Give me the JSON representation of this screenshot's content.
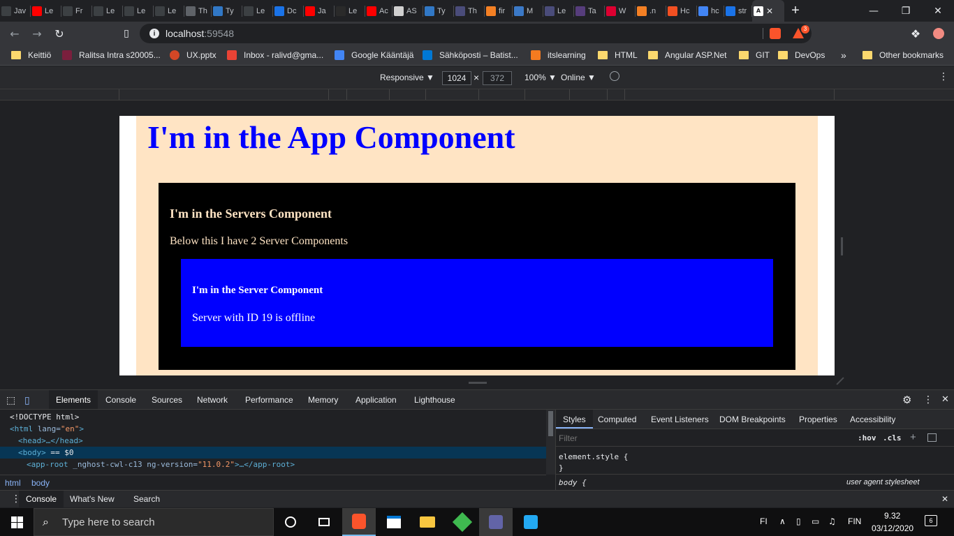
{
  "browser": {
    "tabs": [
      {
        "title": "Jav",
        "icon": "doc-icon",
        "color": "#3c4043"
      },
      {
        "title": "Le",
        "icon": "youtube-icon",
        "color": "#ff0000"
      },
      {
        "title": "Fr",
        "icon": "r-icon",
        "color": "#3c4043"
      },
      {
        "title": "Le",
        "icon": "doc-icon",
        "color": "#3c4043"
      },
      {
        "title": "Le",
        "icon": "doc-icon",
        "color": "#3c4043"
      },
      {
        "title": "Le",
        "icon": "doc-icon",
        "color": "#3c4043"
      },
      {
        "title": "Th",
        "icon": "globe-icon",
        "color": "#5f6368"
      },
      {
        "title": "Ty",
        "icon": "ts-icon",
        "color": "#3178c6"
      },
      {
        "title": "Le",
        "icon": "doc-icon",
        "color": "#3c4043"
      },
      {
        "title": "Dc",
        "icon": "bracket-icon",
        "color": "#1a73e8"
      },
      {
        "title": "Ja",
        "icon": "youtube-icon",
        "color": "#ff0000"
      },
      {
        "title": "Le",
        "icon": "sq-icon",
        "color": "#2a2a2a"
      },
      {
        "title": "Ac",
        "icon": "youtube-icon",
        "color": "#ff0000"
      },
      {
        "title": "AS",
        "icon": "asp-icon",
        "color": "#d0d0d0"
      },
      {
        "title": "Ty",
        "icon": "ts-icon",
        "color": "#3178c6"
      },
      {
        "title": "Th",
        "icon": "angular-icon",
        "color": "#4a4c7a"
      },
      {
        "title": "fir",
        "icon": "stackoverflow-icon",
        "color": "#f48024"
      },
      {
        "title": "M",
        "icon": "mdn-icon",
        "color": "#3b79c7"
      },
      {
        "title": "Le",
        "icon": "angular-icon",
        "color": "#4a4c7a"
      },
      {
        "title": "Ta",
        "icon": "bootstrap-icon",
        "color": "#563d7c"
      },
      {
        "title": "W",
        "icon": "angular-red-icon",
        "color": "#dd0031"
      },
      {
        "title": ".n",
        "icon": "stackoverflow-icon",
        "color": "#f48024"
      },
      {
        "title": "Hc",
        "icon": "microsoft-icon",
        "color": "#f25022"
      },
      {
        "title": "hc",
        "icon": "google-icon",
        "color": "#4285f4"
      },
      {
        "title": "str",
        "icon": "doc-blue-icon",
        "color": "#1a73e8"
      }
    ],
    "active_tab": {
      "title": "",
      "icon": "angular-icon",
      "close": "✕"
    },
    "new_tab": "+",
    "url_host": "localhost",
    "url_port": ":59548",
    "brave_badge": "3",
    "window": {
      "minimize": "—",
      "restore": "❐",
      "close": "✕"
    }
  },
  "bookmarks": [
    {
      "label": "Keittiö",
      "type": "folder"
    },
    {
      "label": "Ralitsa Intra s20005...",
      "type": "site",
      "color": "#7a1f3d"
    },
    {
      "label": "UX.pptx",
      "type": "site",
      "color": "#d24726"
    },
    {
      "label": "Inbox - ralivd@gma...",
      "type": "gmail",
      "color": "#ea4335"
    },
    {
      "label": "Google Kääntäjä",
      "type": "site",
      "color": "#4285f4"
    },
    {
      "label": "Sähköposti – Batist...",
      "type": "site",
      "color": "#0078d4"
    },
    {
      "label": "itslearning",
      "type": "site",
      "color": "#f47b20"
    },
    {
      "label": "HTML",
      "type": "folder"
    },
    {
      "label": "Angular ASP.Net",
      "type": "folder"
    },
    {
      "label": "GIT",
      "type": "folder"
    },
    {
      "label": "DevOps",
      "type": "folder"
    }
  ],
  "bookmarks_more": "»",
  "other_bookmarks": "Other bookmarks",
  "device_toolbar": {
    "mode": "Responsive ▼",
    "width": "1024",
    "times": "×",
    "height": "372",
    "zoom": "100% ▼",
    "network": "Online ▼"
  },
  "page": {
    "app_title": "I'm in the App Component",
    "servers_title": "I'm in the Servers Component",
    "servers_text": "Below this I have 2 Server Components",
    "server_title": "I'm in the Server Component",
    "server_text": "Server with ID 19 is offline"
  },
  "devtools": {
    "tabs": [
      "Elements",
      "Console",
      "Sources",
      "Network",
      "Performance",
      "Memory",
      "Application",
      "Lighthouse"
    ],
    "active_tab": "Elements",
    "dom": {
      "doctype": "<!DOCTYPE html>",
      "html_open": "<html",
      "html_attr": " lang=",
      "html_attr_val": "\"en\"",
      "html_close": ">",
      "head": "<head>…</head>",
      "body": "<body>",
      "body_suffix": " == $0",
      "approot_open": "<app-root",
      "approot_attr1": " _nghost-cwl-c13",
      "approot_attr2": " ng-version=",
      "approot_attr2_val": "\"11.0.2\"",
      "approot_close": ">…</app-root>"
    },
    "breadcrumbs": [
      "html",
      "body"
    ],
    "styles_tabs": [
      "Styles",
      "Computed",
      "Event Listeners",
      "DOM Breakpoints",
      "Properties",
      "Accessibility"
    ],
    "filter_placeholder": "Filter",
    "hov": ":hov",
    "cls": ".cls",
    "element_style": "element.style {",
    "close_brace": "}",
    "body_rule": "body {",
    "user_agent": "user agent stylesheet",
    "drawer_tabs": [
      "Console",
      "What's New",
      "Search"
    ]
  },
  "taskbar": {
    "search_placeholder": "Type here to search",
    "lang": "FI",
    "lang2": "FIN",
    "time": "9.32",
    "date": "03/12/2020",
    "notifications": "6"
  }
}
